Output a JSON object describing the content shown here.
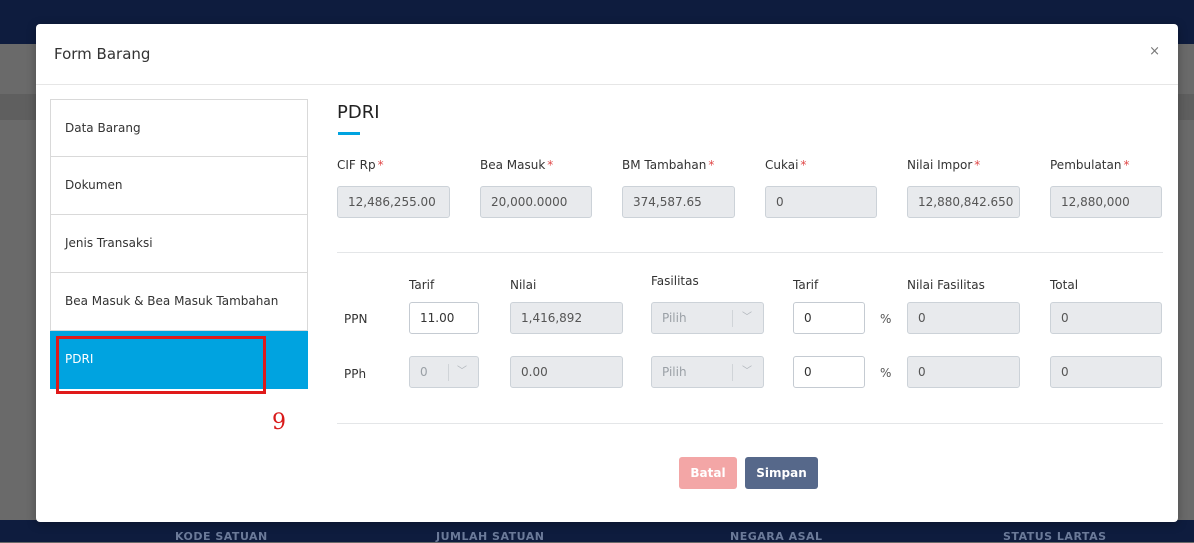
{
  "background": {
    "footer_columns": [
      "KODE SATUAN",
      "JUMLAH SATUAN",
      "NEGARA ASAL",
      "STATUS LARTAS"
    ]
  },
  "modal": {
    "title": "Form Barang",
    "close_label": "×"
  },
  "sidebar": {
    "items": [
      {
        "label": "Data Barang"
      },
      {
        "label": "Dokumen"
      },
      {
        "label": "Jenis Transaksi"
      },
      {
        "label": "Bea Masuk & Bea Masuk Tambahan"
      },
      {
        "label": "PDRI",
        "active": true
      }
    ]
  },
  "annotation": {
    "step_number": "9",
    "color": "#e01a1a"
  },
  "pdri": {
    "title": "PDRI",
    "summary": [
      {
        "label": "CIF Rp",
        "required": "*",
        "value": "12,486,255.00"
      },
      {
        "label": "Bea Masuk",
        "required": "*",
        "value": "20,000.0000"
      },
      {
        "label": "BM Tambahan",
        "required": "*",
        "value": "374,587.65"
      },
      {
        "label": "Cukai",
        "required": "*",
        "value": "0"
      },
      {
        "label": "Nilai Impor",
        "required": "*",
        "value": "12,880,842.650"
      },
      {
        "label": "Pembulatan",
        "required": "*",
        "value": "12,880,000"
      }
    ],
    "headers": {
      "tarif": "Tarif",
      "nilai": "Nilai",
      "fasilitas": "Fasilitas",
      "tarif_fasilitas": "Tarif",
      "nilai_fasilitas": "Nilai Fasilitas",
      "total": "Total"
    },
    "rows": [
      {
        "label": "PPN",
        "tarif": "11.00",
        "nilai": "1,416,892",
        "fasilitas": "Pilih",
        "tarif_fasilitas": "0",
        "percent": "%",
        "nilai_fasilitas": "0",
        "total": "0"
      },
      {
        "label": "PPh",
        "tarif": "0",
        "nilai": "0.00",
        "fasilitas": "Pilih",
        "tarif_fasilitas": "0",
        "percent": "%",
        "nilai_fasilitas": "0",
        "total": "0"
      }
    ]
  },
  "buttons": {
    "cancel": "Batal",
    "save": "Simpan"
  },
  "colors": {
    "accent": "#00a3e0",
    "cancel_button": "#f3a6a6",
    "save_button": "#56688a",
    "required": "#e04848"
  }
}
